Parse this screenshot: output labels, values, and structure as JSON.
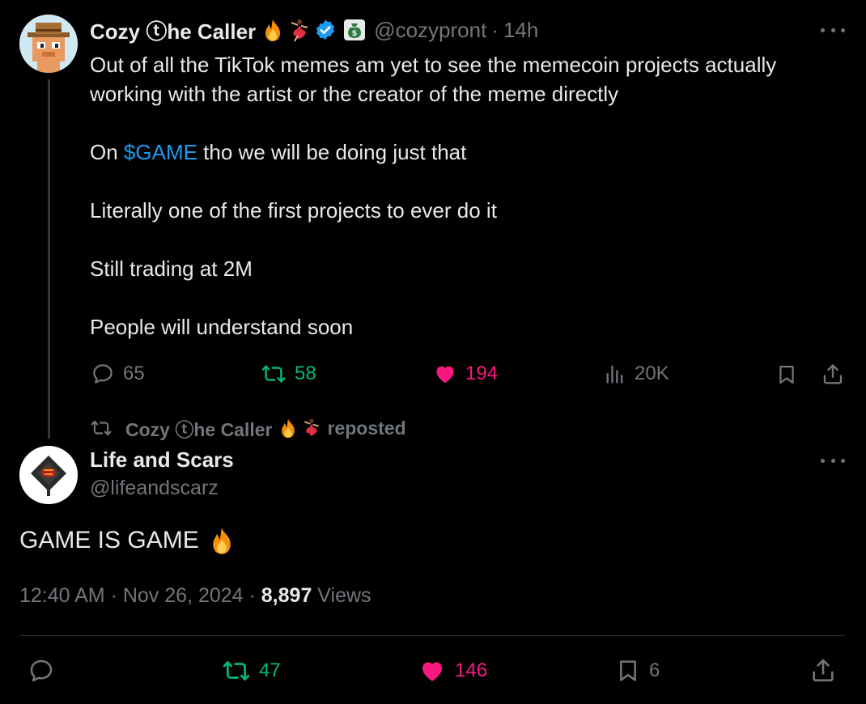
{
  "tweet1": {
    "author_name": "Cozy ⓣhe Caller",
    "handle": "@cozypront",
    "time": "14h",
    "text_lines": [
      "Out of all the TikTok memes am yet to see the memecoin projects actually",
      "working with the artist or the creator of the meme directly"
    ],
    "line2_prefix": "On ",
    "cashtag": "$GAME",
    "line2_suffix": " tho we will be doing just that",
    "line3": "Literally one of the first projects to ever do it",
    "line4": "Still trading at 2M",
    "line5": "People will understand soon",
    "replies": "65",
    "reposts": "58",
    "likes": "194",
    "views": "20K"
  },
  "repost_banner": {
    "name": "Cozy ⓣhe Caller",
    "label": "reposted"
  },
  "tweet2": {
    "author_name": "Life and Scars",
    "handle": "@lifeandscarz",
    "text": "GAME IS GAME",
    "timestamp": "12:40 AM · Nov 26, 2024 · ",
    "views_count": "8,897",
    "views_label": " Views",
    "reposts": "47",
    "likes": "146",
    "bookmarks": "6"
  },
  "colors": {
    "accent": "#1d9bf0",
    "muted": "#71767b",
    "repost": "#00ba7c",
    "like": "#f91880",
    "background": "#000000"
  },
  "icons": [
    "reply-icon",
    "repost-icon",
    "heart-icon",
    "views-icon",
    "bookmark-icon",
    "share-icon",
    "more-icon",
    "verified-badge-icon",
    "fire-emoji-icon",
    "dancer-emoji-icon",
    "money-bag-icon"
  ]
}
